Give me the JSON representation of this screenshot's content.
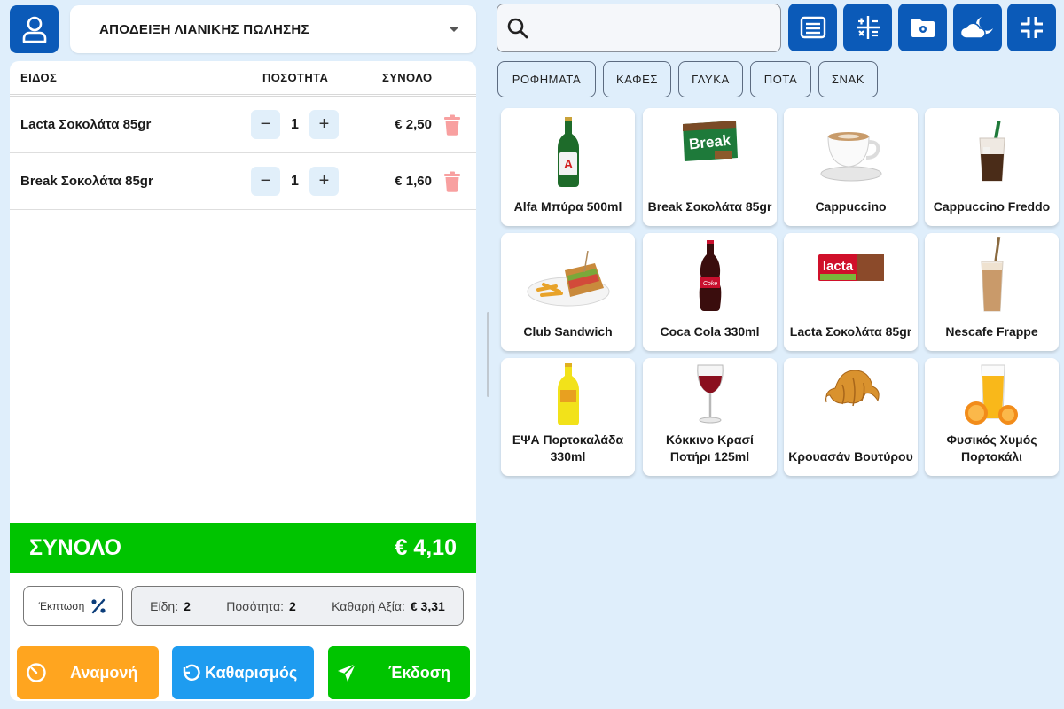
{
  "header": {
    "document_type": "ΑΠΟΔΕΙΞΗ ΛΙΑΝΙΚΗΣ ΠΩΛΗΣΗΣ"
  },
  "cart": {
    "columns": {
      "item": "ΕΙΔΟΣ",
      "quantity": "ΠΟΣΟΤΗΤΑ",
      "total": "ΣΥΝΟΛΟ"
    },
    "items": [
      {
        "name": "Lacta Σοκολάτα 85gr",
        "qty": "1",
        "price": "€ 2,50"
      },
      {
        "name": "Break Σοκολάτα 85gr",
        "qty": "1",
        "price": "€ 1,60"
      }
    ],
    "minus": "−",
    "plus": "+",
    "total_label": "ΣΥΝΟΛΟ",
    "total_value": "€ 4,10"
  },
  "summary": {
    "discount_label": "Έκπτωση",
    "items_label": "Είδη:",
    "items_value": "2",
    "qty_label": "Ποσότητα:",
    "qty_value": "2",
    "net_label": "Καθαρή Αξία:",
    "net_value": "€ 3,31"
  },
  "actions": {
    "wait": "Αναμονή",
    "clear": "Καθαρισμός",
    "issue": "Έκδοση"
  },
  "search": {
    "placeholder": ""
  },
  "categories": [
    "ΡΟΦΗΜΑΤΑ",
    "ΚΑΦΕΣ",
    "ΓΛΥΚΑ",
    "ΠΟΤΑ",
    "ΣΝΑΚ"
  ],
  "products": [
    {
      "name": "Alfa Μπύρα 500ml",
      "icon": "beer-bottle"
    },
    {
      "name": "Break Σοκολάτα 85gr",
      "icon": "break-chocolate"
    },
    {
      "name": "Cappuccino",
      "icon": "coffee-cup"
    },
    {
      "name": "Cappuccino Freddo",
      "icon": "iced-coffee"
    },
    {
      "name": "Club Sandwich",
      "icon": "sandwich"
    },
    {
      "name": "Coca Cola 330ml",
      "icon": "cola-bottle"
    },
    {
      "name": "Lacta Σοκολάτα 85gr",
      "icon": "lacta-chocolate"
    },
    {
      "name": "Nescafe Frappe",
      "icon": "frappe"
    },
    {
      "name": "ΕΨΑ Πορτοκαλάδα 330ml",
      "icon": "orange-soda"
    },
    {
      "name": "Κόκκινο Κρασί Ποτήρι 125ml",
      "icon": "wine-glass"
    },
    {
      "name": "Κρουασάν Βουτύρου",
      "icon": "croissant"
    },
    {
      "name": "Φυσικός Χυμός Πορτοκάλι",
      "icon": "orange-juice"
    }
  ],
  "colors": {
    "primary": "#0b5ab8",
    "total_green": "#00c400",
    "wait_orange": "#ffa51f",
    "clear_blue": "#1e9cf0",
    "background": "#dfeefb"
  }
}
